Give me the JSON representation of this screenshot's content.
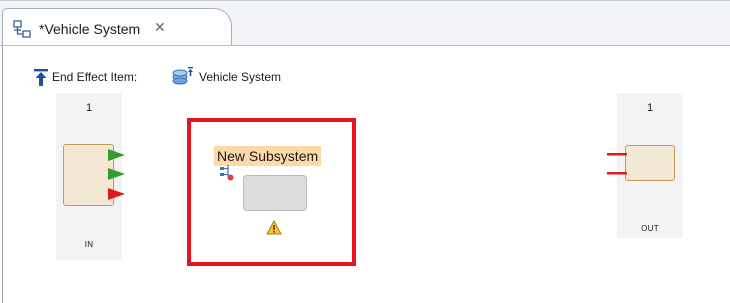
{
  "editor": {
    "tab_title": "*Vehicle System",
    "tab_icon": "diagram-icon",
    "close_icon": "close-icon",
    "close_glyph": "✕"
  },
  "diagram": {
    "end_effect_label": "End Effect Item:",
    "end_effect_value": "Vehicle System",
    "end_effect_icon": "arrow-up-bar-icon",
    "system_icon": "system-icon",
    "in_block": {
      "number": "1",
      "label": "IN",
      "ports": [
        "green",
        "green",
        "red"
      ]
    },
    "out_block": {
      "number": "1",
      "label": "OUT",
      "ports": [
        "red",
        "red"
      ]
    },
    "subsystem": {
      "title": "New Subsystem",
      "type_icon": "subsystem-type-icon",
      "status_icon": "warning-icon"
    },
    "highlight_color": "#e8141b"
  }
}
